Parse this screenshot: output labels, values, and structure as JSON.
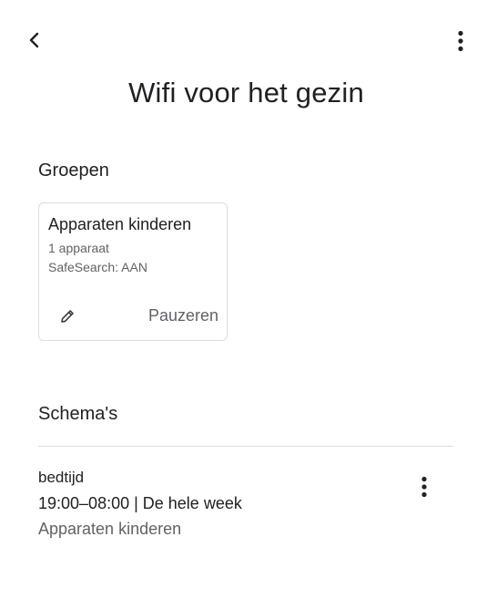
{
  "header": {
    "back_icon": "chevron-left-icon",
    "menu_icon": "more-vert-icon",
    "title": "Wifi voor het gezin"
  },
  "groups": {
    "section_title": "Groepen",
    "items": [
      {
        "name": "Apparaten kinderen",
        "device_count": "1 apparaat",
        "safesearch": "SafeSearch: AAN",
        "edit_icon": "pencil-icon",
        "pause_label": "Pauzeren"
      }
    ]
  },
  "schedules": {
    "section_title": "Schema's",
    "items": [
      {
        "name": "bedtijd",
        "time": "19:00–08:00 | De hele week",
        "group": "Apparaten kinderen",
        "menu_icon": "more-vert-icon"
      }
    ]
  },
  "colors": {
    "text_primary": "#202124",
    "text_secondary": "#5f6368",
    "border": "#dadce0",
    "background": "#ffffff"
  }
}
